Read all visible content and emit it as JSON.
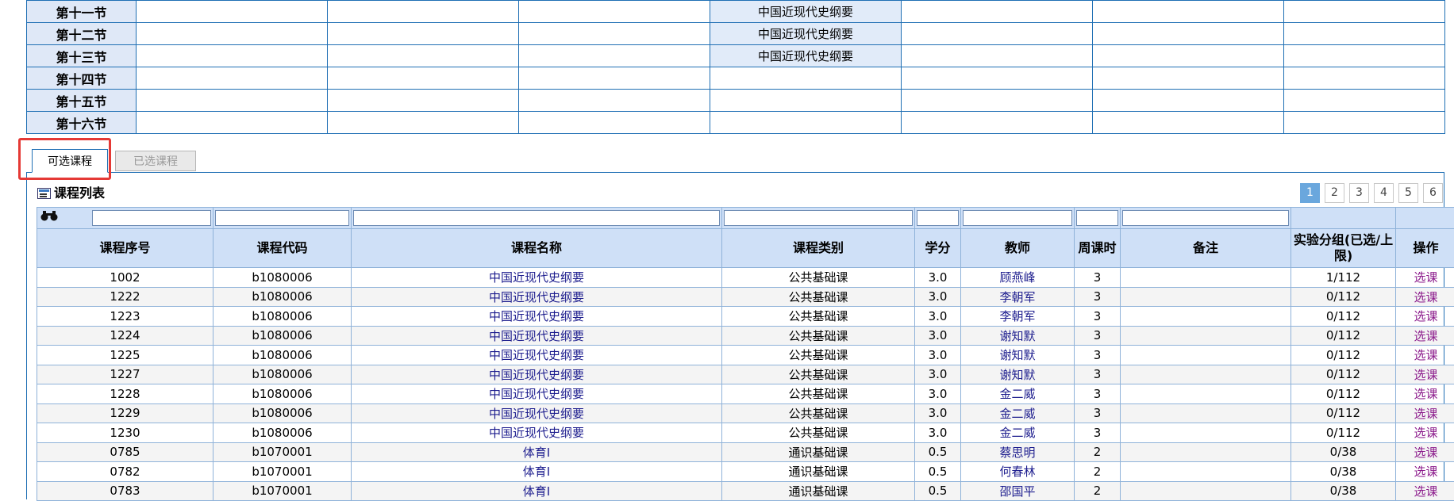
{
  "timetable": {
    "rows": [
      {
        "period": "第十一节",
        "cells": [
          "",
          "",
          "",
          "中国近现代史纲要",
          "",
          "",
          ""
        ]
      },
      {
        "period": "第十二节",
        "cells": [
          "",
          "",
          "",
          "中国近现代史纲要",
          "",
          "",
          ""
        ]
      },
      {
        "period": "第十三节",
        "cells": [
          "",
          "",
          "",
          "中国近现代史纲要",
          "",
          "",
          ""
        ]
      },
      {
        "period": "第十四节",
        "cells": [
          "",
          "",
          "",
          "",
          "",
          "",
          ""
        ]
      },
      {
        "period": "第十五节",
        "cells": [
          "",
          "",
          "",
          "",
          "",
          "",
          ""
        ]
      },
      {
        "period": "第十六节",
        "cells": [
          "",
          "",
          "",
          "",
          "",
          "",
          ""
        ]
      }
    ]
  },
  "tabs": {
    "available": "可选课程",
    "selected": "已选课程"
  },
  "list": {
    "title": "课程列表",
    "pages": [
      "1",
      "2",
      "3",
      "4",
      "5",
      "6"
    ],
    "current_page": "1",
    "headers": [
      "课程序号",
      "课程代码",
      "课程名称",
      "课程类别",
      "学分",
      "教师",
      "周课时",
      "备注",
      "实验分组(已选/上限)",
      "操作"
    ],
    "rows": [
      [
        "1002",
        "b1080006",
        "中国近现代史纲要",
        "公共基础课",
        "3.0",
        "顾燕峰",
        "3",
        "",
        "1/112",
        "选课"
      ],
      [
        "1222",
        "b1080006",
        "中国近现代史纲要",
        "公共基础课",
        "3.0",
        "李朝军",
        "3",
        "",
        "0/112",
        "选课"
      ],
      [
        "1223",
        "b1080006",
        "中国近现代史纲要",
        "公共基础课",
        "3.0",
        "李朝军",
        "3",
        "",
        "0/112",
        "选课"
      ],
      [
        "1224",
        "b1080006",
        "中国近现代史纲要",
        "公共基础课",
        "3.0",
        "谢知默",
        "3",
        "",
        "0/112",
        "选课"
      ],
      [
        "1225",
        "b1080006",
        "中国近现代史纲要",
        "公共基础课",
        "3.0",
        "谢知默",
        "3",
        "",
        "0/112",
        "选课"
      ],
      [
        "1227",
        "b1080006",
        "中国近现代史纲要",
        "公共基础课",
        "3.0",
        "谢知默",
        "3",
        "",
        "0/112",
        "选课"
      ],
      [
        "1228",
        "b1080006",
        "中国近现代史纲要",
        "公共基础课",
        "3.0",
        "金二威",
        "3",
        "",
        "0/112",
        "选课"
      ],
      [
        "1229",
        "b1080006",
        "中国近现代史纲要",
        "公共基础课",
        "3.0",
        "金二威",
        "3",
        "",
        "0/112",
        "选课"
      ],
      [
        "1230",
        "b1080006",
        "中国近现代史纲要",
        "公共基础课",
        "3.0",
        "金二威",
        "3",
        "",
        "0/112",
        "选课"
      ],
      [
        "0785",
        "b1070001",
        "体育I",
        "通识基础课",
        "0.5",
        "蔡思明",
        "2",
        "",
        "0/38",
        "选课"
      ],
      [
        "0782",
        "b1070001",
        "体育I",
        "通识基础课",
        "0.5",
        "何春林",
        "2",
        "",
        "0/38",
        "选课"
      ],
      [
        "0783",
        "b1070001",
        "体育I",
        "通识基础课",
        "0.5",
        "邵国平",
        "2",
        "",
        "0/38",
        "选课"
      ]
    ]
  },
  "icons": {
    "search": "binoculars-icon",
    "list": "list-icon"
  },
  "colors": {
    "border": "#1f6fb4",
    "header_bg": "#cfe0f7",
    "highlight": "#e53935",
    "active_page": "#6aa7dd"
  }
}
